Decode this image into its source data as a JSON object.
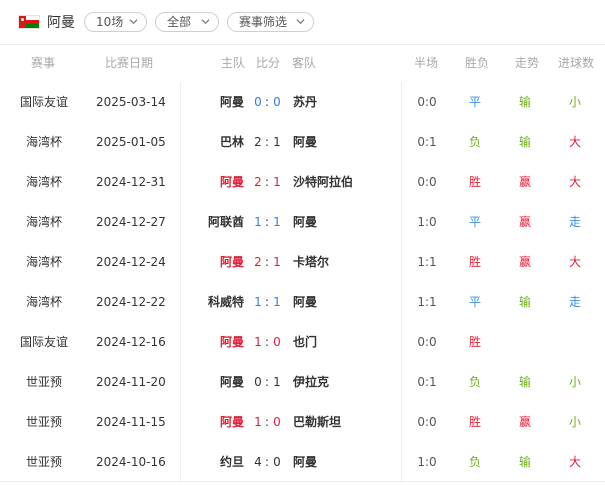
{
  "header": {
    "team_name": "阿曼",
    "filter_count": "10场",
    "filter_scope": "全部",
    "filter_event": "赛事筛选",
    "icons": {
      "flag": "oman-flag-icon",
      "dropdown": "chevron-down-icon"
    }
  },
  "columns": {
    "competition": "赛事",
    "date": "比赛日期",
    "home": "主队",
    "score": "比分",
    "away": "客队",
    "half": "半场",
    "result": "胜负",
    "trend": "走势",
    "ou": "进球数"
  },
  "colors": {
    "team_highlight": "#e0203a",
    "score_draw": "#2f7fdc",
    "win": "#e0203a",
    "draw": "#3a8ee6",
    "lose": "#6cb219"
  },
  "matches": [
    {
      "competition": "国际友谊",
      "date": "2025-03-14",
      "home": "阿曼",
      "home_goals": "0",
      "colon": ":",
      "away_goals": "0",
      "away": "苏丹",
      "half": "0:0",
      "result": "平",
      "trend": "输",
      "ou": "小",
      "home_hl": false,
      "score_color": "blue",
      "result_class": "r-draw",
      "trend_class": "t-lose",
      "ou_class": "o-small"
    },
    {
      "competition": "海湾杯",
      "date": "2025-01-05",
      "home": "巴林",
      "home_goals": "2",
      "colon": ":",
      "away_goals": "1",
      "away": "阿曼",
      "half": "0:1",
      "result": "负",
      "trend": "输",
      "ou": "大",
      "home_hl": false,
      "score_color": "",
      "result_class": "r-lose",
      "trend_class": "t-lose",
      "ou_class": "o-big"
    },
    {
      "competition": "海湾杯",
      "date": "2024-12-31",
      "home": "阿曼",
      "home_goals": "2",
      "colon": ":",
      "away_goals": "1",
      "away": "沙特阿拉伯",
      "half": "0:0",
      "result": "胜",
      "trend": "赢",
      "ou": "大",
      "home_hl": true,
      "score_color": "red",
      "result_class": "r-win",
      "trend_class": "t-win",
      "ou_class": "o-big"
    },
    {
      "competition": "海湾杯",
      "date": "2024-12-27",
      "home": "阿联酋",
      "home_goals": "1",
      "colon": ":",
      "away_goals": "1",
      "away": "阿曼",
      "half": "1:0",
      "result": "平",
      "trend": "赢",
      "ou": "走",
      "home_hl": false,
      "score_color": "blue",
      "result_class": "r-draw",
      "trend_class": "t-win",
      "ou_class": "o-go"
    },
    {
      "competition": "海湾杯",
      "date": "2024-12-24",
      "home": "阿曼",
      "home_goals": "2",
      "colon": ":",
      "away_goals": "1",
      "away": "卡塔尔",
      "half": "1:1",
      "result": "胜",
      "trend": "赢",
      "ou": "大",
      "home_hl": true,
      "score_color": "red",
      "result_class": "r-win",
      "trend_class": "t-win",
      "ou_class": "o-big"
    },
    {
      "competition": "海湾杯",
      "date": "2024-12-22",
      "home": "科威特",
      "home_goals": "1",
      "colon": ":",
      "away_goals": "1",
      "away": "阿曼",
      "half": "1:1",
      "result": "平",
      "trend": "输",
      "ou": "走",
      "home_hl": false,
      "score_color": "blue",
      "result_class": "r-draw",
      "trend_class": "t-lose",
      "ou_class": "o-go"
    },
    {
      "competition": "国际友谊",
      "date": "2024-12-16",
      "home": "阿曼",
      "home_goals": "1",
      "colon": ":",
      "away_goals": "0",
      "away": "也门",
      "half": "0:0",
      "result": "胜",
      "trend": "",
      "ou": "",
      "home_hl": true,
      "score_color": "red",
      "result_class": "r-win",
      "trend_class": "",
      "ou_class": ""
    },
    {
      "competition": "世亚预",
      "date": "2024-11-20",
      "home": "阿曼",
      "home_goals": "0",
      "colon": ":",
      "away_goals": "1",
      "away": "伊拉克",
      "half": "0:1",
      "result": "负",
      "trend": "输",
      "ou": "小",
      "home_hl": false,
      "score_color": "",
      "result_class": "r-lose",
      "trend_class": "t-lose",
      "ou_class": "o-small"
    },
    {
      "competition": "世亚预",
      "date": "2024-11-15",
      "home": "阿曼",
      "home_goals": "1",
      "colon": ":",
      "away_goals": "0",
      "away": "巴勒斯坦",
      "half": "0:0",
      "result": "胜",
      "trend": "赢",
      "ou": "小",
      "home_hl": true,
      "score_color": "red",
      "result_class": "r-win",
      "trend_class": "t-win",
      "ou_class": "o-small"
    },
    {
      "competition": "世亚预",
      "date": "2024-10-16",
      "home": "约旦",
      "home_goals": "4",
      "colon": ":",
      "away_goals": "0",
      "away": "阿曼",
      "half": "1:0",
      "result": "负",
      "trend": "输",
      "ou": "大",
      "home_hl": false,
      "score_color": "",
      "result_class": "r-lose",
      "trend_class": "t-lose",
      "ou_class": "o-big"
    }
  ]
}
